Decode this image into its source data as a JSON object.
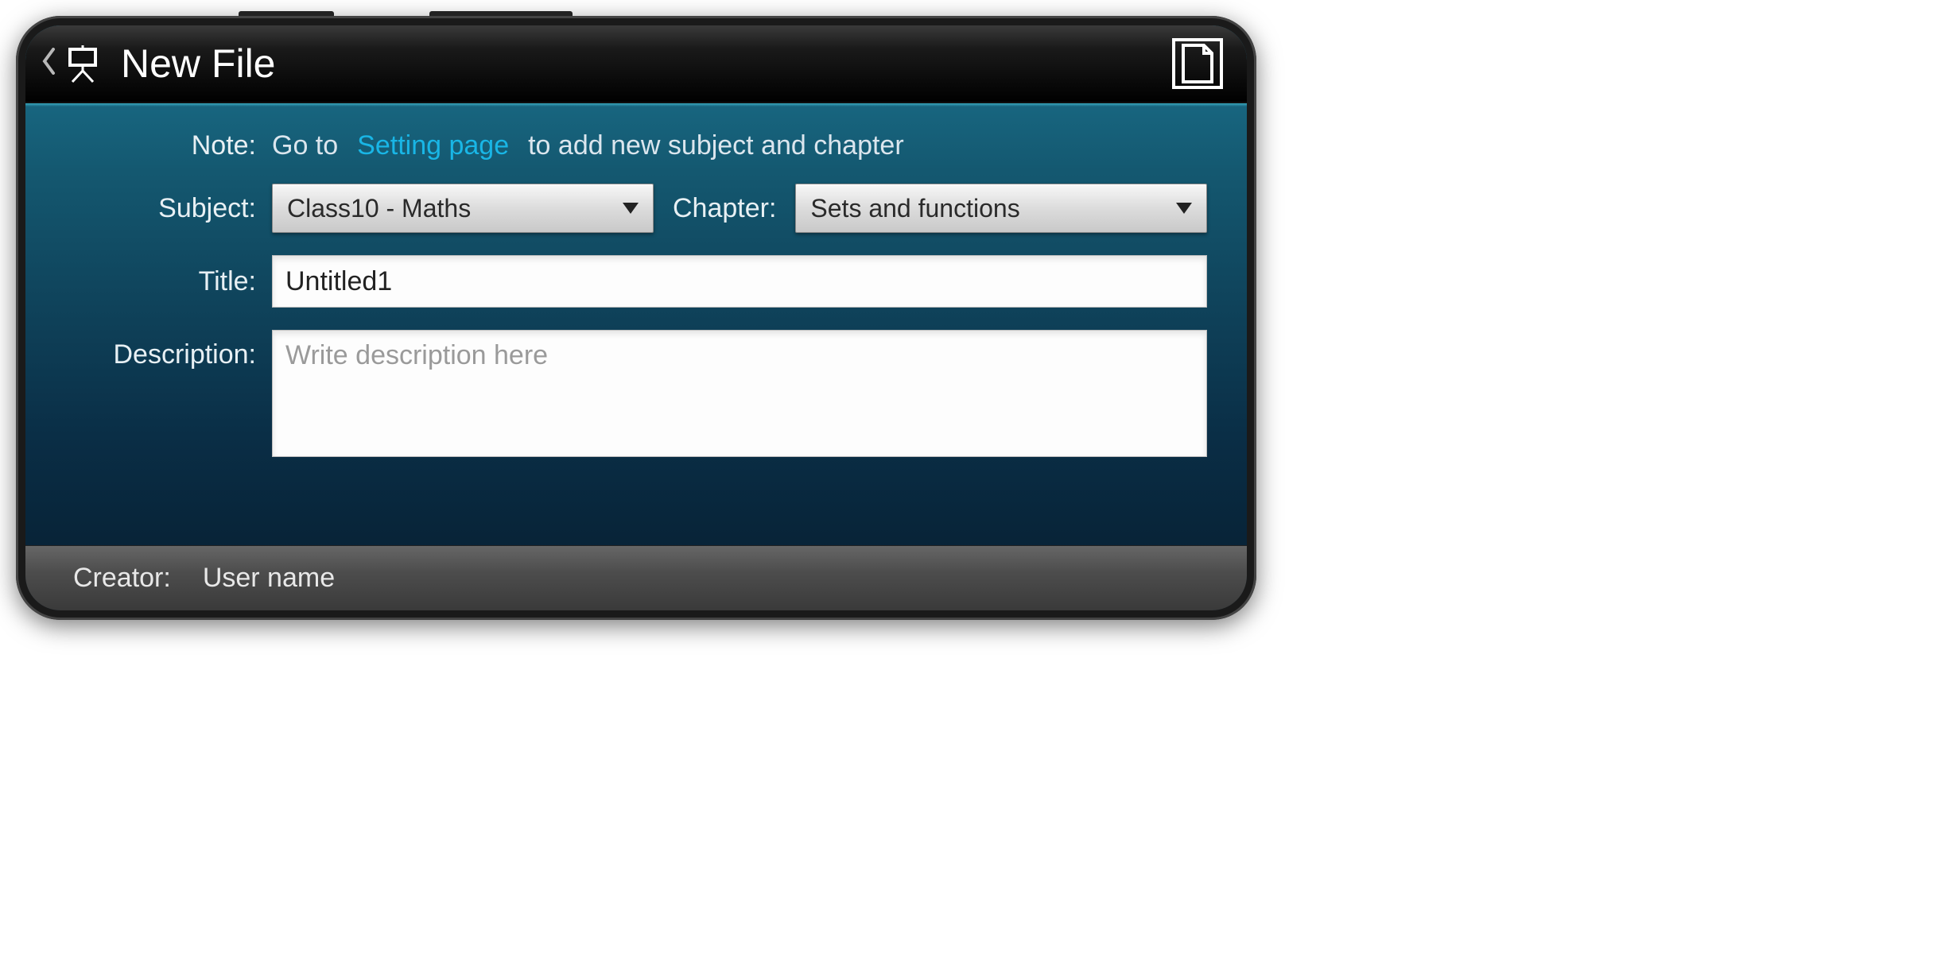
{
  "header": {
    "title": "New File"
  },
  "note": {
    "label": "Note:",
    "prefix": "Go to ",
    "link": "Setting page",
    "suffix": " to add new subject and chapter"
  },
  "subject": {
    "label": "Subject:",
    "value": "Class10 - Maths"
  },
  "chapter": {
    "label": "Chapter:",
    "value": "Sets and functions"
  },
  "title_field": {
    "label": "Title:",
    "value": "Untitled1"
  },
  "description": {
    "label": "Description:",
    "placeholder": "Write description here",
    "value": ""
  },
  "footer": {
    "creator_label": "Creator:",
    "creator_value": "User name"
  }
}
